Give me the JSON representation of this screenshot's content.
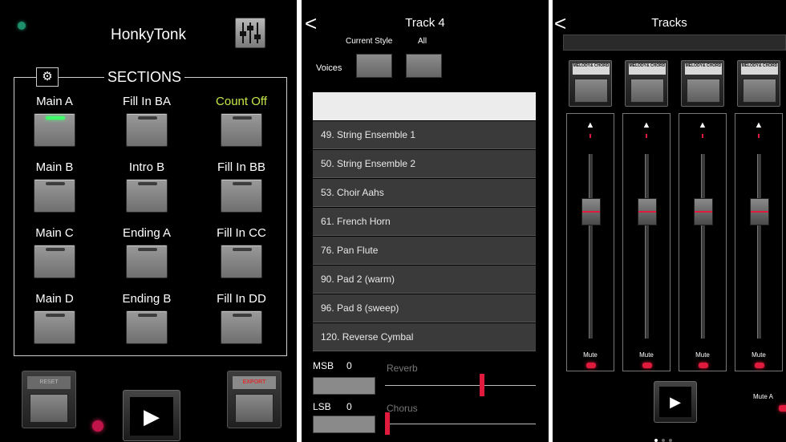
{
  "panel1": {
    "title": "HonkyTonk",
    "sections_label": "SECTIONS",
    "sections": [
      {
        "label": "Main A",
        "active": true
      },
      {
        "label": "Fill In BA",
        "active": false
      },
      {
        "label": "Count Off",
        "active": false,
        "highlight": true
      },
      {
        "label": "Main B",
        "active": false
      },
      {
        "label": "Intro B",
        "active": false
      },
      {
        "label": "Fill In BB",
        "active": false
      },
      {
        "label": "Main C",
        "active": false
      },
      {
        "label": "Ending A",
        "active": false
      },
      {
        "label": "Fill In CC",
        "active": false
      },
      {
        "label": "Main D",
        "active": false
      },
      {
        "label": "Ending B",
        "active": false
      },
      {
        "label": "Fill In DD",
        "active": false
      }
    ],
    "left_button_caption": "RESET",
    "right_button_caption": "EXPORT"
  },
  "panel2": {
    "title": "Track 4",
    "current_style_label": "Current Style",
    "all_label": "All",
    "voices_label": "Voices",
    "voices": [
      "49. String Ensemble 1",
      "50. String Ensemble 2",
      "53. Choir Aahs",
      "61. French Horn",
      "76. Pan Flute",
      "90. Pad 2 (warm)",
      "96. Pad 8 (sweep)",
      "120. Reverse Cymbal"
    ],
    "msb_label": "MSB",
    "msb_value": "0",
    "lsb_label": "LSB",
    "lsb_value": "0",
    "reverb_label": "Reverb",
    "reverb_level": 0.65,
    "chorus_label": "Chorus",
    "chorus_level": 0.0
  },
  "panel3": {
    "title": "Tracks",
    "tracks": [
      {
        "button_label": "MELODY& CHORD",
        "mute_label": "Mute",
        "fader_level": 0.72
      },
      {
        "button_label": "MELODY& CHORD",
        "mute_label": "Mute",
        "fader_level": 0.72
      },
      {
        "button_label": "MELODY& CHORD",
        "mute_label": "Mute",
        "fader_level": 0.72
      },
      {
        "button_label": "MELODY& CHORD",
        "mute_label": "Mute",
        "fader_level": 0.72
      }
    ],
    "mute_all_label": "Mute A",
    "page_count": 3,
    "active_page": 0
  },
  "colors": {
    "background": "#000000",
    "led_green": "#3fff6a",
    "led_red": "#e01a3c",
    "accent_yellow": "#c7e84a"
  }
}
